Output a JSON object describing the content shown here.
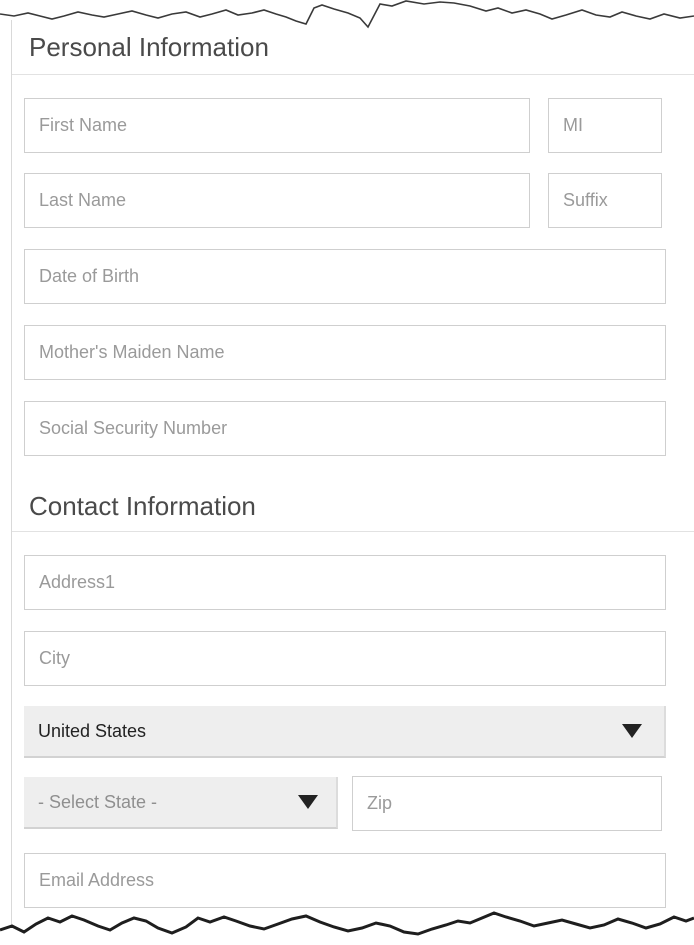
{
  "personal": {
    "title": "Personal Information",
    "first_name_placeholder": "First Name",
    "mi_placeholder": "MI",
    "last_name_placeholder": "Last Name",
    "suffix_placeholder": "Suffix",
    "dob_placeholder": "Date of Birth",
    "maiden_placeholder": "Mother's Maiden Name",
    "ssn_placeholder": "Social Security Number"
  },
  "contact": {
    "title": "Contact Information",
    "address_placeholder": "Address1",
    "city_placeholder": "City",
    "country_value": "United States",
    "state_value": "- Select State -",
    "zip_placeholder": "Zip",
    "email_placeholder": "Email Address"
  },
  "icons": {
    "dropdown": "caret-down-icon"
  },
  "colors": {
    "title_text": "#4a4a4a",
    "placeholder_text": "#9a9a9a",
    "field_border": "#cfcfcf",
    "select_background": "#eeeeee"
  }
}
